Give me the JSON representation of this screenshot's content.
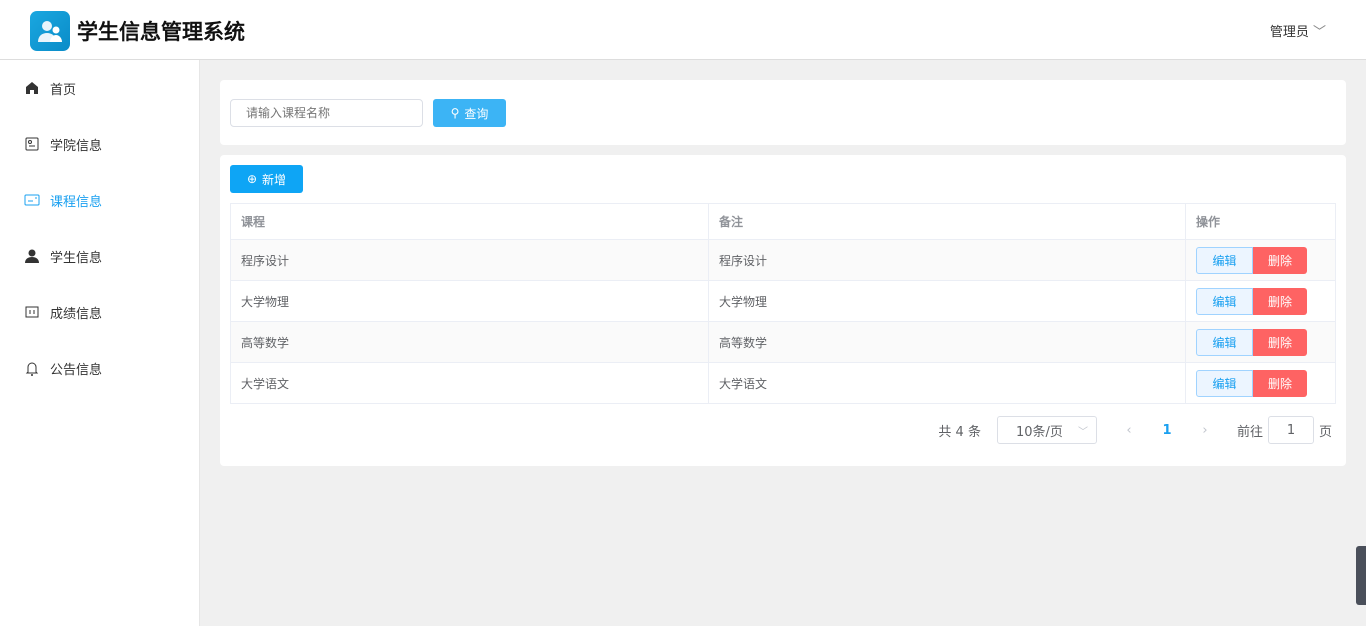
{
  "app": {
    "title": "学生信息管理系统",
    "user": "管理员"
  },
  "sidebar": {
    "items": [
      {
        "label": "首页"
      },
      {
        "label": "学院信息"
      },
      {
        "label": "课程信息"
      },
      {
        "label": "学生信息"
      },
      {
        "label": "成绩信息"
      },
      {
        "label": "公告信息"
      }
    ]
  },
  "search": {
    "placeholder": "请输入课程名称",
    "button": "查询"
  },
  "toolbar": {
    "add": "新增"
  },
  "table": {
    "headers": [
      "课程",
      "备注",
      "操作"
    ],
    "rows": [
      {
        "course": "程序设计",
        "note": "程序设计"
      },
      {
        "course": "大学物理",
        "note": "大学物理"
      },
      {
        "course": "高等数学",
        "note": "高等数学"
      },
      {
        "course": "大学语文",
        "note": "大学语文"
      }
    ],
    "edit": "编辑",
    "delete": "删除"
  },
  "pagination": {
    "total": "共 4 条",
    "page_size": "10条/页",
    "current": "1",
    "goto_label": "前往",
    "goto_value": "1",
    "page_suffix": "页"
  },
  "colors": {
    "accent": "#1aa0f0",
    "danger": "#fe6363"
  }
}
